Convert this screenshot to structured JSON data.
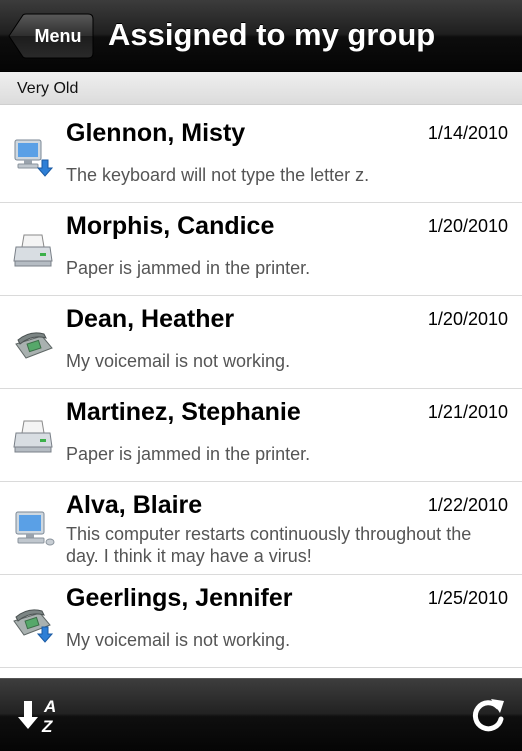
{
  "navbar": {
    "back_label": "Menu",
    "title": "Assigned to my group"
  },
  "section": {
    "header": "Very Old"
  },
  "tickets": [
    {
      "name": "Glennon, Misty",
      "date": "1/14/2010",
      "description": "The keyboard will not type the letter z.",
      "icon": "computer-download-icon"
    },
    {
      "name": "Morphis, Candice",
      "date": "1/20/2010",
      "description": "Paper is jammed in the printer.",
      "icon": "printer-icon"
    },
    {
      "name": "Dean, Heather",
      "date": "1/20/2010",
      "description": "My voicemail is not working.",
      "icon": "phone-icon"
    },
    {
      "name": "Martinez, Stephanie",
      "date": "1/21/2010",
      "description": "Paper is jammed in the printer.",
      "icon": "printer-icon"
    },
    {
      "name": "Alva, Blaire",
      "date": "1/22/2010",
      "description": "This computer restarts continuously throughout the day.  I think it may have a virus!",
      "icon": "computer-icon"
    },
    {
      "name": "Geerlings, Jennifer",
      "date": "1/25/2010",
      "description": "My voicemail is not working.",
      "icon": "phone-download-icon"
    }
  ],
  "toolbar": {
    "sort_icon": "sort-az-icon",
    "refresh_icon": "refresh-icon"
  }
}
